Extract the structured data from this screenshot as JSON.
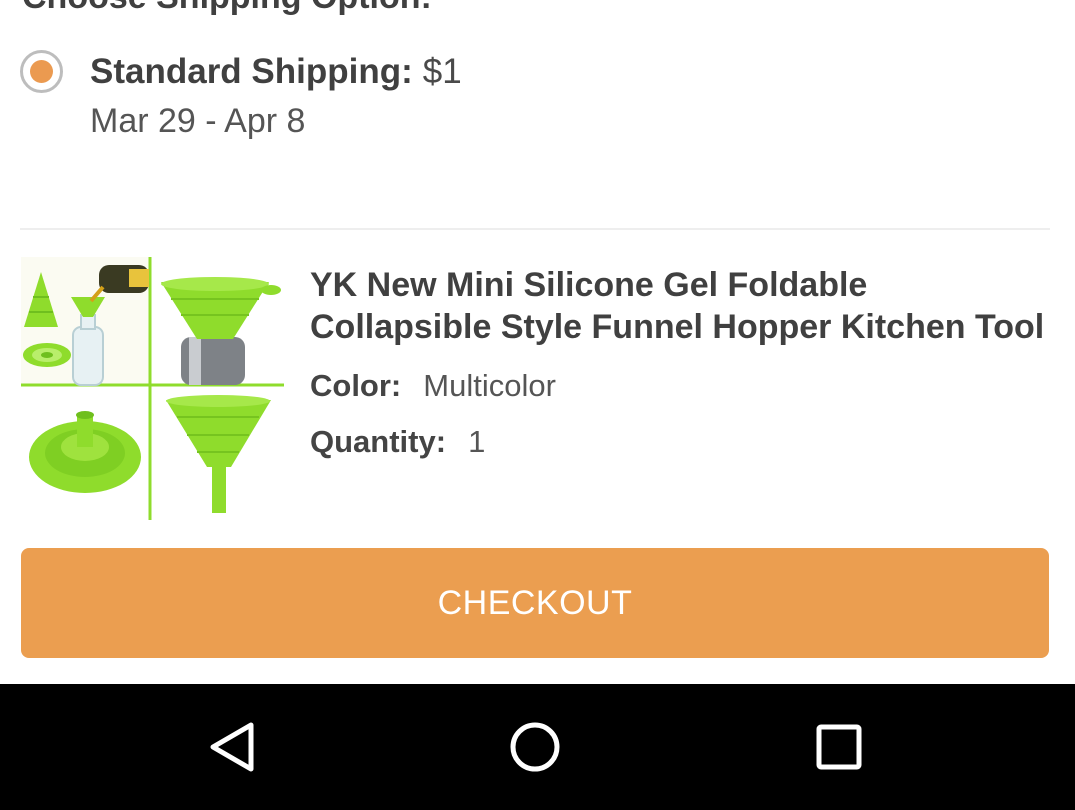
{
  "shipping": {
    "heading": "Choose Shipping Option:",
    "option": {
      "name": "Standard Shipping:",
      "price": "$1",
      "dates": "Mar 29 - Apr 8",
      "selected": true
    }
  },
  "product": {
    "title": "YK New Mini Silicone Gel Foldable Collapsible Style Funnel Hopper Kitchen Tool",
    "color_label": "Color:",
    "color_value": "Multicolor",
    "quantity_label": "Quantity:",
    "quantity_value": "1",
    "image_icon": "funnel-product-photo"
  },
  "checkout": {
    "label": "CHECKOUT"
  },
  "colors": {
    "accent": "#eb9e50",
    "radio_dot": "#eb9a50",
    "product_green": "#8fdc2c",
    "nav_bar": "#000000"
  },
  "nav": {
    "back_icon": "back-triangle-icon",
    "home_icon": "home-circle-icon",
    "recents_icon": "recents-square-icon"
  }
}
